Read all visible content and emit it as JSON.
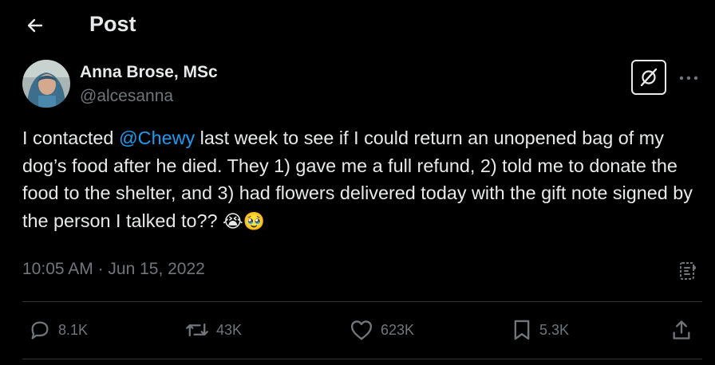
{
  "header": {
    "title": "Post"
  },
  "author": {
    "name": "Anna Brose, MSc",
    "handle": "@alcesanna"
  },
  "tweet": {
    "text_before": "I contacted ",
    "mention": "@Chewy",
    "text_after": " last week to see if I could return an unopened bag of my dog’s food after he died. They 1) gave me a full refund, 2) told me to donate the food to the shelter, and 3) had flowers delivered today with the gift note signed by the person I talked to?? ",
    "emojis": "😭🥹"
  },
  "meta": {
    "time": "10:05 AM",
    "separator": " · ",
    "date": "Jun 15, 2022"
  },
  "actions": {
    "replies": "8.1K",
    "reposts": "43K",
    "likes": "623K",
    "bookmarks": "5.3K"
  },
  "colors": {
    "background": "#000000",
    "text": "#e7e9ea",
    "muted": "#71767b",
    "link": "#1d9bf0",
    "divider": "#2f3336"
  },
  "icons": [
    "arrow-left-icon",
    "grok-icon",
    "more-icon",
    "analytics-icon",
    "reply-icon",
    "repost-icon",
    "like-icon",
    "bookmark-icon",
    "share-icon"
  ]
}
